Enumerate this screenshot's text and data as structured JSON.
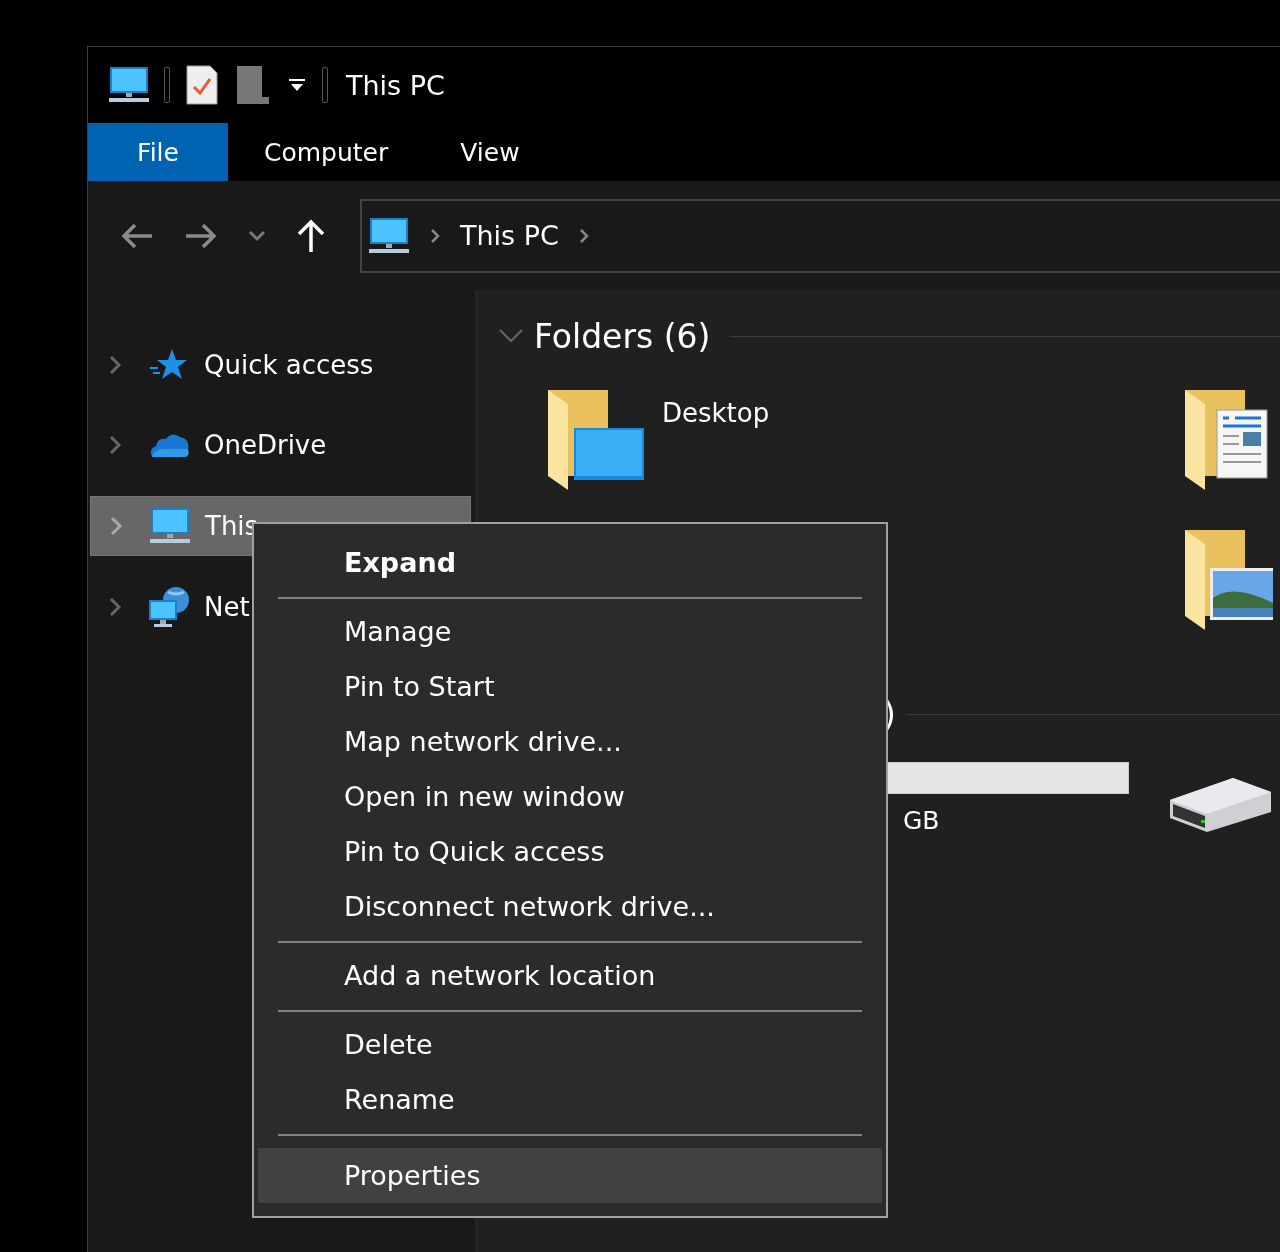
{
  "window": {
    "title": "This PC"
  },
  "ribbon_tabs": [
    {
      "label": "File",
      "selected": true
    },
    {
      "label": "Computer",
      "selected": false
    },
    {
      "label": "View",
      "selected": false
    }
  ],
  "address_bar": {
    "path": [
      "This PC"
    ]
  },
  "sidebar": {
    "items": [
      {
        "label": "Quick access",
        "kind": "star",
        "selected": false,
        "expanded": false
      },
      {
        "label": "OneDrive",
        "kind": "cloud",
        "selected": false,
        "expanded": false
      },
      {
        "label": "This",
        "kind": "pc",
        "selected": true,
        "expanded": false
      },
      {
        "label": "Net",
        "kind": "network",
        "selected": false,
        "expanded": false
      }
    ]
  },
  "groups": [
    {
      "title": "Folders (6)",
      "expanded": true,
      "folders": [
        {
          "name": "Desktop",
          "kind": "desktop"
        },
        {
          "kind": "documents"
        },
        {
          "kind": "pictures"
        }
      ]
    },
    {
      "title": ")",
      "drive": {
        "caption": "GB"
      }
    }
  ],
  "context_menu": {
    "items": [
      {
        "kind": "item",
        "label": "Expand",
        "default": true,
        "highlighted": false
      },
      {
        "kind": "separator"
      },
      {
        "kind": "item",
        "label": "Manage",
        "default": false,
        "highlighted": false
      },
      {
        "kind": "item",
        "label": "Pin to Start",
        "default": false,
        "highlighted": false
      },
      {
        "kind": "item",
        "label": "Map network drive...",
        "default": false,
        "highlighted": false
      },
      {
        "kind": "item",
        "label": "Open in new window",
        "default": false,
        "highlighted": false
      },
      {
        "kind": "item",
        "label": "Pin to Quick access",
        "default": false,
        "highlighted": false
      },
      {
        "kind": "item",
        "label": "Disconnect network drive...",
        "default": false,
        "highlighted": false
      },
      {
        "kind": "separator"
      },
      {
        "kind": "item",
        "label": "Add a network location",
        "default": false,
        "highlighted": false
      },
      {
        "kind": "separator"
      },
      {
        "kind": "item",
        "label": "Delete",
        "default": false,
        "highlighted": false
      },
      {
        "kind": "item",
        "label": "Rename",
        "default": false,
        "highlighted": false
      },
      {
        "kind": "separator"
      },
      {
        "kind": "item",
        "label": "Properties",
        "default": false,
        "highlighted": true
      }
    ]
  }
}
